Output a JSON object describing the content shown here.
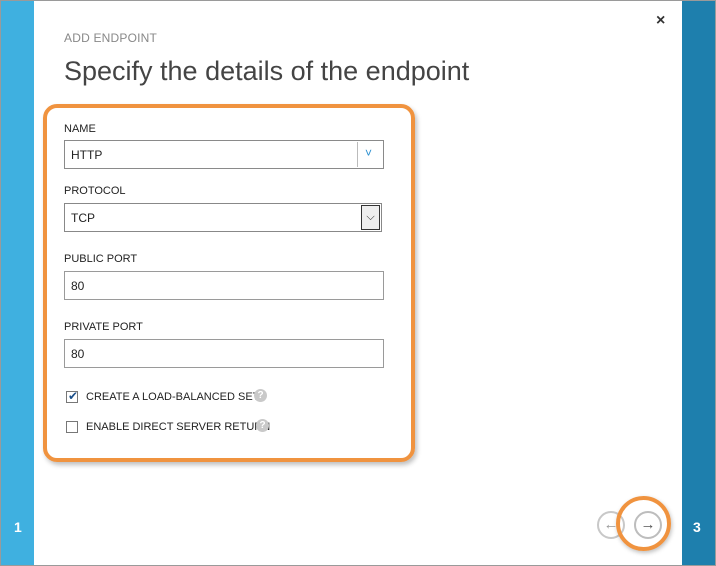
{
  "wizard": {
    "subtitle": "ADD ENDPOINT",
    "title": "Specify the details of the endpoint",
    "current_step": "1",
    "next_step": "3",
    "close_glyph": "×"
  },
  "form": {
    "name_label": "NAME",
    "name_value": "HTTP",
    "protocol_label": "PROTOCOL",
    "protocol_value": "TCP",
    "public_port_label": "PUBLIC PORT",
    "public_port_value": "80",
    "private_port_label": "PRIVATE PORT",
    "private_port_value": "80",
    "load_balanced_label": "CREATE A LOAD-BALANCED SET",
    "load_balanced_checked": true,
    "direct_return_label": "ENABLE DIRECT SERVER RETURN",
    "direct_return_checked": false
  },
  "icons": {
    "close": "close-icon",
    "dropdown": "chevron-down-icon",
    "help": "help-icon",
    "prev": "arrow-left-icon",
    "next": "arrow-right-icon"
  },
  "colors": {
    "left_rail": "#3fb0e0",
    "right_rail": "#1e7fad",
    "highlight": "#f0933f"
  }
}
